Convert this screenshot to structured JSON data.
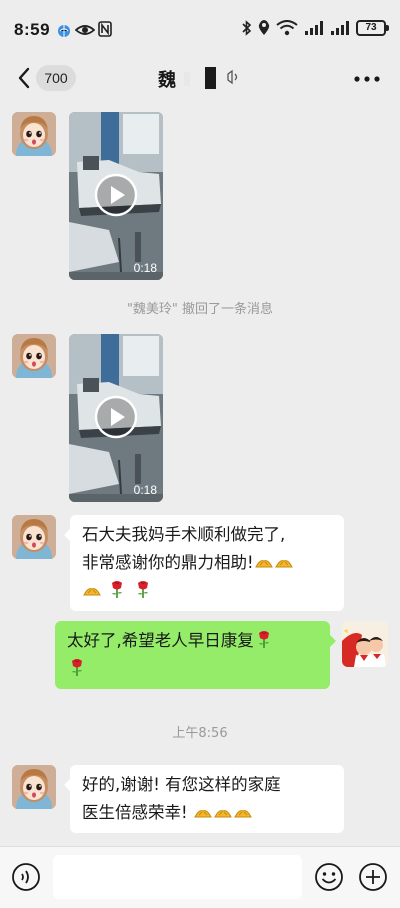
{
  "status": {
    "time": "8:59",
    "battery": "73"
  },
  "nav": {
    "back_count": "700",
    "title": "魏"
  },
  "messages": {
    "recall_notice": "\"魏美玲\" 撤回了一条消息",
    "video1_duration": "0:18",
    "video2_duration": "0:18",
    "text1_line1": "石大夫我妈手术顺利做完了,",
    "text1_line2": "非常感谢你的鼎力相助!",
    "reply_text": "太好了,希望老人早日康复",
    "timestamp": "上午8:56",
    "text2_line1": "好的,谢谢! 有您这样的家庭",
    "text2_line2": "医生倍感荣幸!"
  },
  "icons": {
    "back": "chevron-left-icon",
    "mute": "mute-icon",
    "more": "more-dots-icon",
    "play": "play-icon",
    "voice": "voice-icon",
    "emoji": "emoji-icon",
    "plus": "plus-icon",
    "thumbs": "thumbs-up-emoji",
    "rose": "rose-emoji"
  },
  "colors": {
    "background": "#ededed",
    "my_bubble": "#95ec69",
    "their_bubble": "#ffffff"
  }
}
